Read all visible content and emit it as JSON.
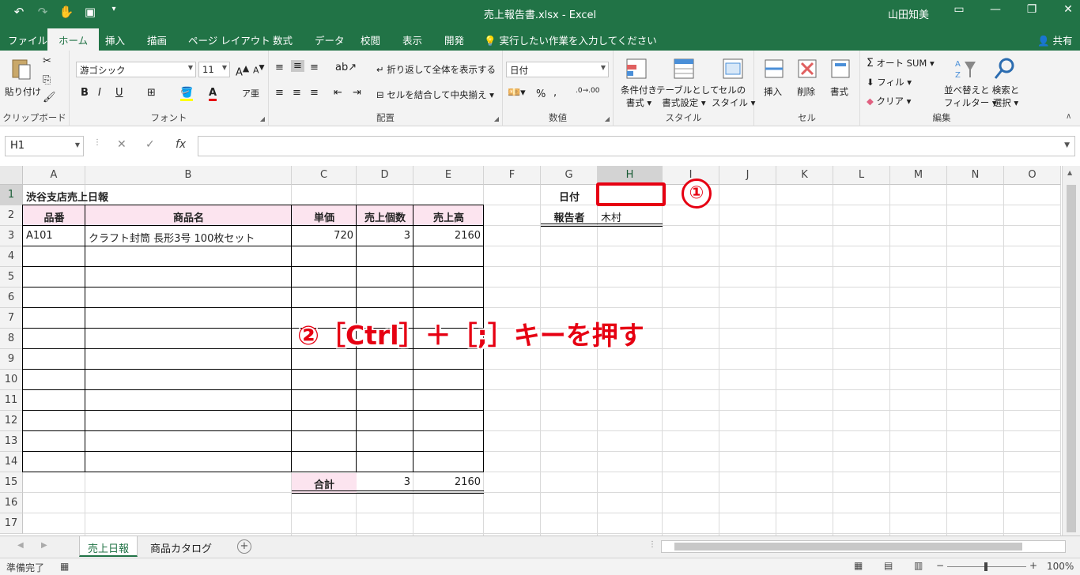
{
  "titlebar": {
    "title": "売上報告書.xlsx - Excel",
    "user": "山田知美"
  },
  "tabs": [
    "ファイル",
    "ホーム",
    "挿入",
    "描画",
    "ページ レイアウト",
    "数式",
    "データ",
    "校閲",
    "表示",
    "開発"
  ],
  "active_tab": "ホーム",
  "tellme": "実行したい作業を入力してください",
  "share": "共有",
  "ribbon": {
    "clipboard": {
      "label": "クリップボード",
      "paste": "貼り付け"
    },
    "font": {
      "label": "フォント",
      "font_name": "游ゴシック",
      "font_size": "11",
      "bold": "B",
      "italic": "I",
      "underline": "U"
    },
    "alignment": {
      "label": "配置",
      "wrap": "折り返して全体を表示する",
      "merge": "セルを結合して中央揃え"
    },
    "number": {
      "label": "数値",
      "format": "日付",
      "percent": "%"
    },
    "styles": {
      "label": "スタイル",
      "conditional": "条件付き",
      "conditional2": "書式",
      "table": "テーブルとして",
      "table2": "書式設定",
      "cell": "セルの",
      "cell2": "スタイル"
    },
    "cells": {
      "label": "セル",
      "insert": "挿入",
      "delete": "削除",
      "format": "書式"
    },
    "editing": {
      "label": "編集",
      "autosum": "オート SUM",
      "fill": "フィル",
      "clear": "クリア",
      "sort": "並べ替えと",
      "sort2": "フィルター",
      "find": "検索と",
      "find2": "選択"
    }
  },
  "formula_bar": {
    "namebox": "H1",
    "fx": "fx"
  },
  "columns": [
    "A",
    "B",
    "C",
    "D",
    "E",
    "F",
    "G",
    "H",
    "I",
    "J",
    "K",
    "L",
    "M",
    "N",
    "O"
  ],
  "rows": [
    "1",
    "2",
    "3",
    "4",
    "5",
    "6",
    "7",
    "8",
    "9",
    "10",
    "11",
    "12",
    "13",
    "14",
    "15",
    "16",
    "17"
  ],
  "cells": {
    "A1": "渋谷支店売上日報",
    "A2": "品番",
    "B2": "商品名",
    "C2": "単価",
    "D2": "売上個数",
    "E2": "売上高",
    "A3": "A101",
    "B3": "クラフト封筒 長形3号 100枚セット",
    "C3": "720",
    "D3": "3",
    "E3": "2160",
    "C15": "合計",
    "D15": "3",
    "E15": "2160",
    "G1": "日付",
    "G2": "報告者",
    "H2": "木村"
  },
  "sheets": [
    "売上日報",
    "商品カタログ"
  ],
  "active_sheet": "売上日報",
  "status": {
    "ready": "準備完了",
    "zoom": "100%"
  },
  "annotations": {
    "marker1": "①",
    "instruction": "②［Ctrl］＋［;］キーを押す"
  },
  "colors": {
    "excel_green": "#217346",
    "pink_fill": "#fce4ef",
    "annotation_red": "#e60012"
  }
}
